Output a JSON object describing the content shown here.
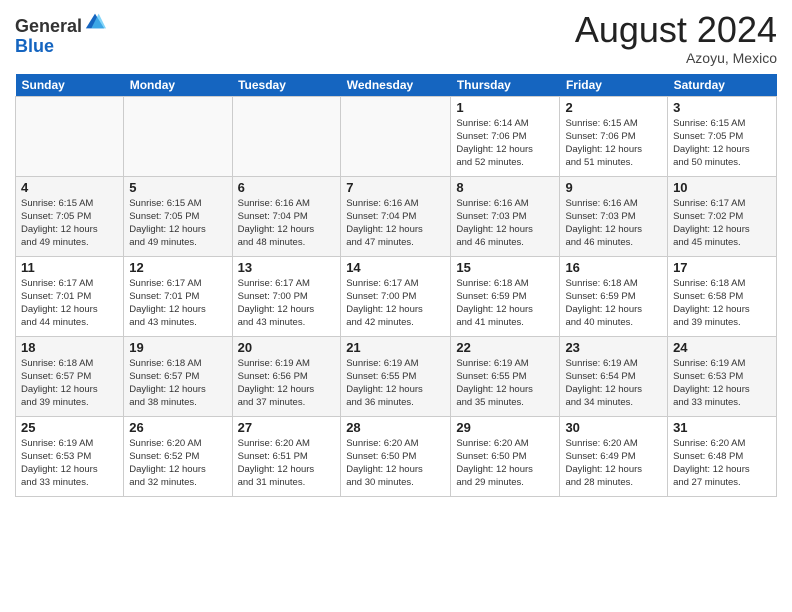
{
  "logo": {
    "line1": "General",
    "line2": "Blue"
  },
  "title": "August 2024",
  "subtitle": "Azoyu, Mexico",
  "days_header": [
    "Sunday",
    "Monday",
    "Tuesday",
    "Wednesday",
    "Thursday",
    "Friday",
    "Saturday"
  ],
  "weeks": [
    [
      {
        "day": "",
        "info": ""
      },
      {
        "day": "",
        "info": ""
      },
      {
        "day": "",
        "info": ""
      },
      {
        "day": "",
        "info": ""
      },
      {
        "day": "1",
        "info": "Sunrise: 6:14 AM\nSunset: 7:06 PM\nDaylight: 12 hours\nand 52 minutes."
      },
      {
        "day": "2",
        "info": "Sunrise: 6:15 AM\nSunset: 7:06 PM\nDaylight: 12 hours\nand 51 minutes."
      },
      {
        "day": "3",
        "info": "Sunrise: 6:15 AM\nSunset: 7:05 PM\nDaylight: 12 hours\nand 50 minutes."
      }
    ],
    [
      {
        "day": "4",
        "info": "Sunrise: 6:15 AM\nSunset: 7:05 PM\nDaylight: 12 hours\nand 49 minutes."
      },
      {
        "day": "5",
        "info": "Sunrise: 6:15 AM\nSunset: 7:05 PM\nDaylight: 12 hours\nand 49 minutes."
      },
      {
        "day": "6",
        "info": "Sunrise: 6:16 AM\nSunset: 7:04 PM\nDaylight: 12 hours\nand 48 minutes."
      },
      {
        "day": "7",
        "info": "Sunrise: 6:16 AM\nSunset: 7:04 PM\nDaylight: 12 hours\nand 47 minutes."
      },
      {
        "day": "8",
        "info": "Sunrise: 6:16 AM\nSunset: 7:03 PM\nDaylight: 12 hours\nand 46 minutes."
      },
      {
        "day": "9",
        "info": "Sunrise: 6:16 AM\nSunset: 7:03 PM\nDaylight: 12 hours\nand 46 minutes."
      },
      {
        "day": "10",
        "info": "Sunrise: 6:17 AM\nSunset: 7:02 PM\nDaylight: 12 hours\nand 45 minutes."
      }
    ],
    [
      {
        "day": "11",
        "info": "Sunrise: 6:17 AM\nSunset: 7:01 PM\nDaylight: 12 hours\nand 44 minutes."
      },
      {
        "day": "12",
        "info": "Sunrise: 6:17 AM\nSunset: 7:01 PM\nDaylight: 12 hours\nand 43 minutes."
      },
      {
        "day": "13",
        "info": "Sunrise: 6:17 AM\nSunset: 7:00 PM\nDaylight: 12 hours\nand 43 minutes."
      },
      {
        "day": "14",
        "info": "Sunrise: 6:17 AM\nSunset: 7:00 PM\nDaylight: 12 hours\nand 42 minutes."
      },
      {
        "day": "15",
        "info": "Sunrise: 6:18 AM\nSunset: 6:59 PM\nDaylight: 12 hours\nand 41 minutes."
      },
      {
        "day": "16",
        "info": "Sunrise: 6:18 AM\nSunset: 6:59 PM\nDaylight: 12 hours\nand 40 minutes."
      },
      {
        "day": "17",
        "info": "Sunrise: 6:18 AM\nSunset: 6:58 PM\nDaylight: 12 hours\nand 39 minutes."
      }
    ],
    [
      {
        "day": "18",
        "info": "Sunrise: 6:18 AM\nSunset: 6:57 PM\nDaylight: 12 hours\nand 39 minutes."
      },
      {
        "day": "19",
        "info": "Sunrise: 6:18 AM\nSunset: 6:57 PM\nDaylight: 12 hours\nand 38 minutes."
      },
      {
        "day": "20",
        "info": "Sunrise: 6:19 AM\nSunset: 6:56 PM\nDaylight: 12 hours\nand 37 minutes."
      },
      {
        "day": "21",
        "info": "Sunrise: 6:19 AM\nSunset: 6:55 PM\nDaylight: 12 hours\nand 36 minutes."
      },
      {
        "day": "22",
        "info": "Sunrise: 6:19 AM\nSunset: 6:55 PM\nDaylight: 12 hours\nand 35 minutes."
      },
      {
        "day": "23",
        "info": "Sunrise: 6:19 AM\nSunset: 6:54 PM\nDaylight: 12 hours\nand 34 minutes."
      },
      {
        "day": "24",
        "info": "Sunrise: 6:19 AM\nSunset: 6:53 PM\nDaylight: 12 hours\nand 33 minutes."
      }
    ],
    [
      {
        "day": "25",
        "info": "Sunrise: 6:19 AM\nSunset: 6:53 PM\nDaylight: 12 hours\nand 33 minutes."
      },
      {
        "day": "26",
        "info": "Sunrise: 6:20 AM\nSunset: 6:52 PM\nDaylight: 12 hours\nand 32 minutes."
      },
      {
        "day": "27",
        "info": "Sunrise: 6:20 AM\nSunset: 6:51 PM\nDaylight: 12 hours\nand 31 minutes."
      },
      {
        "day": "28",
        "info": "Sunrise: 6:20 AM\nSunset: 6:50 PM\nDaylight: 12 hours\nand 30 minutes."
      },
      {
        "day": "29",
        "info": "Sunrise: 6:20 AM\nSunset: 6:50 PM\nDaylight: 12 hours\nand 29 minutes."
      },
      {
        "day": "30",
        "info": "Sunrise: 6:20 AM\nSunset: 6:49 PM\nDaylight: 12 hours\nand 28 minutes."
      },
      {
        "day": "31",
        "info": "Sunrise: 6:20 AM\nSunset: 6:48 PM\nDaylight: 12 hours\nand 27 minutes."
      }
    ]
  ]
}
